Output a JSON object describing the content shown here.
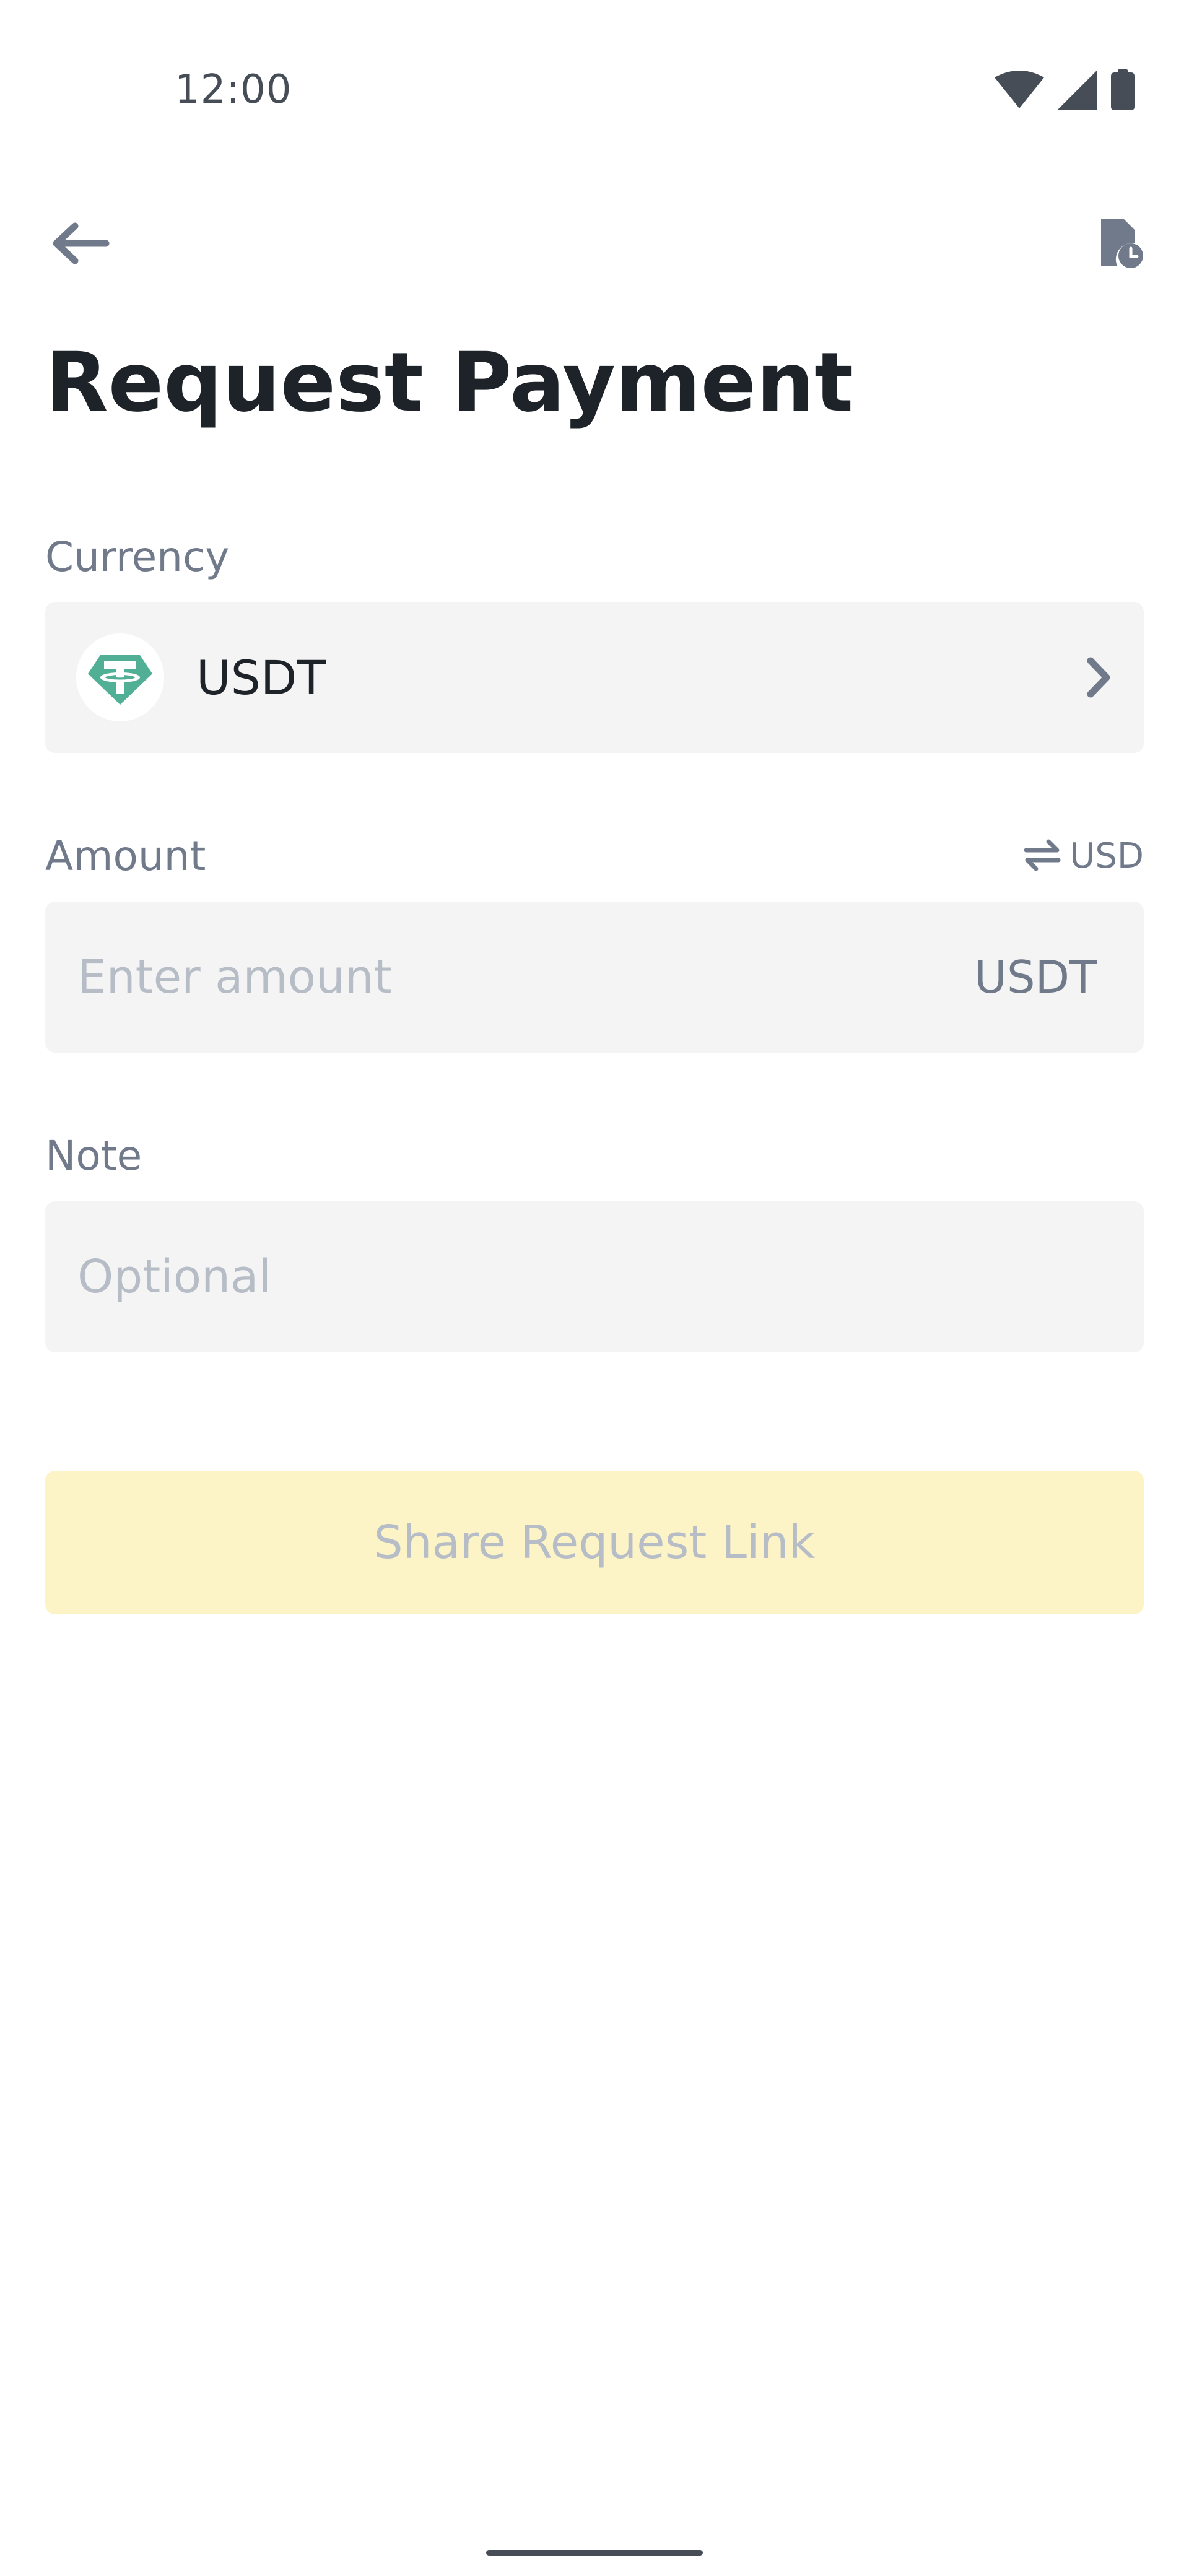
{
  "status_bar": {
    "time": "12:00",
    "icons": [
      "wifi-icon",
      "cellular-signal-icon",
      "battery-icon"
    ]
  },
  "toolbar": {
    "back_icon": "arrow-left-icon",
    "history_icon": "document-clock-icon"
  },
  "page": {
    "title": "Request Payment"
  },
  "currency": {
    "label": "Currency",
    "selected": "USDT",
    "coin_icon": "tether-logo",
    "coin_color": "#50AF95",
    "chevron_icon": "chevron-right-icon"
  },
  "amount": {
    "label": "Amount",
    "toggle_icon": "swap-arrows-icon",
    "toggle_unit": "USD",
    "placeholder": "Enter amount",
    "value": "",
    "unit": "USDT"
  },
  "note": {
    "label": "Note",
    "placeholder": "Optional",
    "value": ""
  },
  "share_button": {
    "label": "Share Request Link",
    "background_color": "#FCF3C7",
    "text_color": "#B7BDC6"
  }
}
